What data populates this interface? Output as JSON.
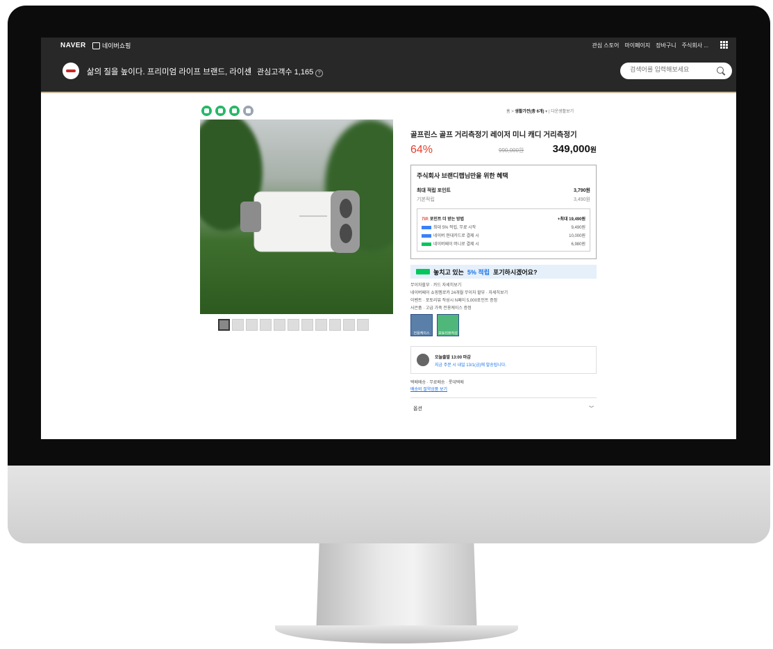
{
  "header": {
    "naver_label": "NAVER",
    "shopping_label": "네이버쇼핑",
    "gnb": [
      "관심 스토어",
      "마이페이지",
      "장바구니",
      "주식회사 ..."
    ],
    "slogan": "삶의 질을 높이다. 프리미엄 라이프 브랜드, 라이센",
    "fans": "관심고객수 1,165",
    "search_placeholder": "검색어를 입력해보세요"
  },
  "breadcrumb": {
    "home": "홈",
    "category": "생활가전(총 6개)",
    "more": "다운생활보기"
  },
  "product": {
    "title": "골프린스 골프 거리측정기 레이저 미니 캐디 거리측정기",
    "discount": "64%",
    "original_price": "990,000원",
    "sale_price": "349,000",
    "won": "원"
  },
  "benefit": {
    "title": "주식회사 브랜디랩님만을 위한 혜택",
    "max_points_label": "최대 적립 포인트",
    "max_points_value": "3,790원",
    "base_label": "기본적립",
    "base_value": "3,490원",
    "tip_badge": "TIP.",
    "tip_label": "포인트 더 받는 방법",
    "tip_value": "+최대 19,490원",
    "tips": [
      {
        "label": "최대 5% 적립, 무료 시작",
        "value": "9,490원"
      },
      {
        "label": "네이버 현대카드로 결제 시",
        "value": "10,000원"
      },
      {
        "label": "네이버페이 머니로 결제 시",
        "value": "6,980원"
      }
    ]
  },
  "banner": {
    "pre": "놓치고 있는",
    "highlight": "5% 적립",
    "post": "포기하시겠어요?"
  },
  "extra": {
    "installment": "무이자할부 · 카드 자세히보기",
    "npay_installment": "네이버페이 쇼핑멤로카 24개월 무이자 할부 · 자세히보기",
    "event": "이벤트 · 포토리뷰 작성시 N페이 5,000포인트 증정",
    "gift": "사은품 · 고급 가죽 전용케이스 증정",
    "gift1": "전용케이스",
    "gift2": "포토리뷰작성"
  },
  "shipping": {
    "title": "오늘출발 13:00 마감",
    "sub": "지금 주문 시 내일 13/1(금)에 발송됩니다.",
    "delivery": "택배배송 · 무료배송 · 롯데택배",
    "link": "배송비 절약상품 보기"
  },
  "option_label": "옵션",
  "colors": {
    "accent": "#e23f2c",
    "topbar": "#282828",
    "link": "#1a73e8"
  }
}
